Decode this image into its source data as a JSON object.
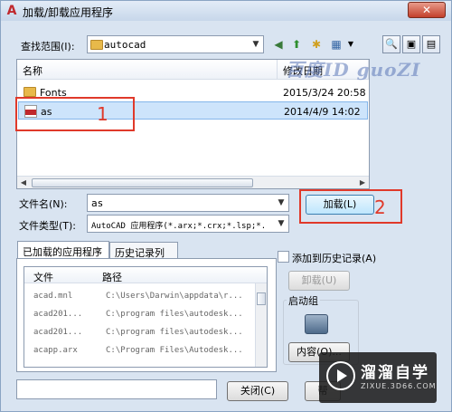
{
  "window": {
    "title": "加载/卸载应用程序",
    "close_glyph": "✕",
    "app_icon": "autocad-icon"
  },
  "lookin": {
    "label": "查找范围(I):",
    "value": "autocad"
  },
  "toolbar": {
    "back": "◀",
    "up": "⬆",
    "newfolder": "✱",
    "views": "▦",
    "tool1": "🔍",
    "tool2": "▣",
    "tool3": "▤"
  },
  "file_list": {
    "columns": [
      "名称",
      "修改日期"
    ],
    "rows": [
      {
        "name": "Fonts",
        "date": "2015/3/24 20:58",
        "type": "folder"
      },
      {
        "name": "as",
        "date": "2014/4/9 14:02",
        "type": "lsp",
        "selected": true
      }
    ]
  },
  "watermark": "百度ID guoZI",
  "annotations": {
    "num1": "1",
    "num2": "2"
  },
  "filename": {
    "label": "文件名(N):",
    "value": "as"
  },
  "filetype": {
    "label": "文件类型(T):",
    "value": "AutoCAD 应用程序(*.arx;*.crx;*.lsp;*."
  },
  "load_button": "加载(L)",
  "tabs": [
    "已加载的应用程序",
    "历史记录列表"
  ],
  "loaded_table": {
    "columns": [
      "文件",
      "路径"
    ],
    "rows": [
      {
        "file": "acad.mnl",
        "path": "C:\\Users\\Darwin\\appdata\\r..."
      },
      {
        "file": "acad201...",
        "path": "C:\\program files\\autodesk..."
      },
      {
        "file": "acad201...",
        "path": "C:\\program files\\autodesk..."
      },
      {
        "file": "acapp.arx",
        "path": "C:\\Program Files\\Autodesk..."
      }
    ]
  },
  "add_history": "添加到历史记录(A)",
  "unload_button": "卸载(U)",
  "startup_group": {
    "title": "启动组",
    "contents_button": "内容(O)..."
  },
  "close_button": "关闭(C)",
  "help_button": "帮",
  "logo": {
    "main": "溜溜自学",
    "sub": "ZIXUE.3D66.COM"
  }
}
